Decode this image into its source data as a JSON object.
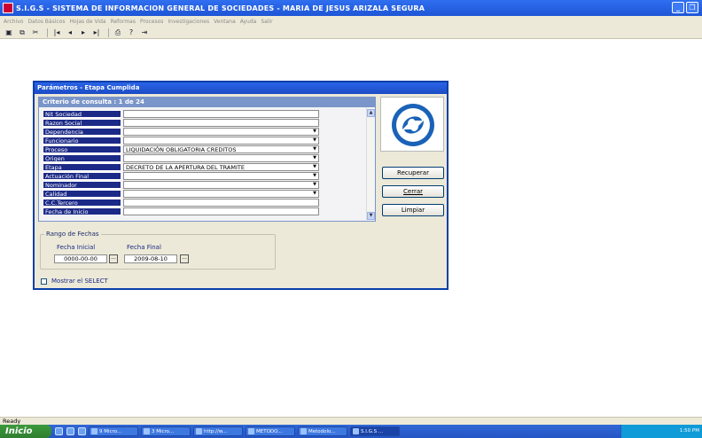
{
  "window": {
    "title": "S.I.G.S  - SISTEMA DE INFORMACION GENERAL DE SOCIEDADES - MARIA DE JESUS ARIZALA SEGURA"
  },
  "menu": [
    "Archivo",
    "Datos Básicos",
    "Hojas de Vida",
    "Reformas",
    "Procesos",
    "Investigaciones",
    "Ventana",
    "Ayuda",
    "Salir"
  ],
  "dialog": {
    "title": "Parámetros - Etapa Cumplida",
    "criteria_header": "Criterio de consulta : 1  de  24",
    "fields": [
      {
        "label": "Nit Sociedad",
        "value": "",
        "dropdown": false
      },
      {
        "label": "Razon Social",
        "value": "",
        "dropdown": false
      },
      {
        "label": "Dependencia",
        "value": "",
        "dropdown": true
      },
      {
        "label": "Funcionario",
        "value": "",
        "dropdown": true
      },
      {
        "label": "Proceso",
        "value": "LIQUIDACIÓN OBLIGATORIA CREDITOS",
        "dropdown": true
      },
      {
        "label": "Origen",
        "value": "",
        "dropdown": true
      },
      {
        "label": "Etapa",
        "value": "DECRETO DE LA APERTURA DEL TRAMITE",
        "dropdown": true
      },
      {
        "label": "Actuación Final",
        "value": "",
        "dropdown": true
      },
      {
        "label": "Nominador",
        "value": "",
        "dropdown": true
      },
      {
        "label": "Calidad",
        "value": "",
        "dropdown": true
      },
      {
        "label": "C.C.Tercero",
        "value": "",
        "dropdown": false
      },
      {
        "label": "Fecha de Inicio",
        "value": "",
        "dropdown": false
      }
    ],
    "buttons": {
      "recuperar": "Recuperar",
      "cerrar": "Cerrar",
      "limpiar": "Limpiar"
    },
    "rango": {
      "legend": "Rango de Fechas",
      "fecha_inicial_label": "Fecha Inicial",
      "fecha_final_label": "Fecha Final",
      "fecha_inicial": "0000-00-00",
      "fecha_final": "2009-08-10",
      "picker": "..."
    },
    "mostrar_select": "Mostrar el SELECT"
  },
  "status": "Ready",
  "taskbar": {
    "start": "Inicio",
    "tasks": [
      "9 Micro...",
      "3 Micro...",
      "http://w...",
      "METODO...",
      "Metodolo...",
      "S.I.G.S ..."
    ],
    "clock": "1:50 PM"
  },
  "colors": {
    "titlebar": "#1e55d6",
    "label_bg": "#1c2a87",
    "dialog_bg": "#ece9d8",
    "logo": "#1a62b8"
  }
}
